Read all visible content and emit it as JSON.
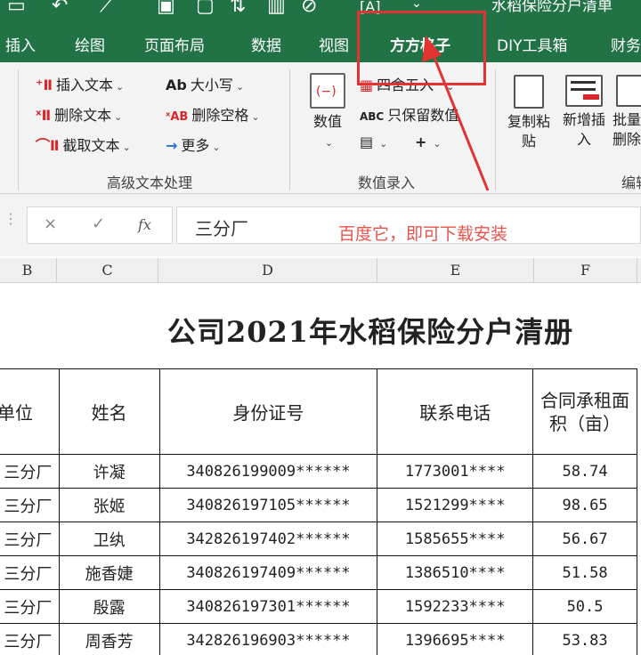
{
  "window": {
    "title": "水稻保险分户清单"
  },
  "quick_access_icons": [
    "save-icon",
    "undo-icon",
    "redo-icon",
    "print-preview-icon",
    "open-icon",
    "sort-icon",
    "chart-icon",
    "link-icon",
    "text-a-icon",
    "dropdown-icon"
  ],
  "tabs": [
    {
      "label": "插入",
      "active": false
    },
    {
      "label": "绘图",
      "active": false
    },
    {
      "label": "页面布局",
      "active": false
    },
    {
      "label": "数据",
      "active": false
    },
    {
      "label": "视图",
      "active": false
    },
    {
      "label": "方方格子",
      "active": true
    },
    {
      "label": "DIY工具箱",
      "active": false
    },
    {
      "label": "财务",
      "active": false
    }
  ],
  "ribbon": {
    "text_group": {
      "items": [
        {
          "label": "插入文本",
          "icon": "insert-text-icon"
        },
        {
          "label": "删除文本",
          "icon": "delete-text-icon"
        },
        {
          "label": "截取文本",
          "icon": "extract-text-icon"
        },
        {
          "label": "大小写",
          "icon": "case-icon",
          "glyph": "Ab"
        },
        {
          "label": "删除空格",
          "icon": "remove-space-icon",
          "glyph": "ˣAB"
        },
        {
          "label": "更多",
          "icon": "more-arrow-icon",
          "glyph": "→"
        }
      ],
      "group_label": "高级文本处理"
    },
    "number_group": {
      "big_button_label": "数值",
      "items": [
        {
          "label": "四舍五入",
          "icon": "round-icon"
        },
        {
          "label": "只保留数值",
          "icon": "keep-value-icon",
          "glyph": "ABC"
        }
      ],
      "group_label": "数值录入"
    },
    "edit_group": {
      "buttons": [
        {
          "label": "复制粘贴",
          "icon": "copy-paste-icon"
        },
        {
          "label": "新增插入",
          "icon": "new-insert-icon"
        },
        {
          "label": "批量删除",
          "icon": "batch-delete-icon"
        }
      ],
      "group_label": "编辑"
    }
  },
  "formula_bar": {
    "cancel_icon": "×",
    "confirm_icon": "✓",
    "fx_label": "fx",
    "value": "三分厂"
  },
  "annotation": {
    "text": "百度它，即可下载安装",
    "color": "#e8534a"
  },
  "columns": [
    "B",
    "C",
    "D",
    "E",
    "F"
  ],
  "sheet": {
    "title": "公司2021年水稻保险分户清册",
    "headers": [
      "单位",
      "姓名",
      "身份证号",
      "联系电话",
      "合同承租面积（亩）"
    ],
    "rows": [
      [
        "三分厂",
        "许凝",
        "340826199009******",
        "1773001****",
        "58.74"
      ],
      [
        "三分厂",
        "张姬",
        "340826197105******",
        "1521299****",
        "98.65"
      ],
      [
        "三分厂",
        "卫纨",
        "342826197402******",
        "1585655****",
        "56.67"
      ],
      [
        "三分厂",
        "施香婕",
        "340826197409******",
        "1386510****",
        "51.58"
      ],
      [
        "三分厂",
        "殷露",
        "340826197301******",
        "1592233****",
        "50.5"
      ],
      [
        "三分厂",
        "周香芳",
        "342826196903******",
        "1396695****",
        "53.83"
      ]
    ]
  },
  "colors": {
    "excel_green": "#217346",
    "highlight_red": "#e23232"
  }
}
